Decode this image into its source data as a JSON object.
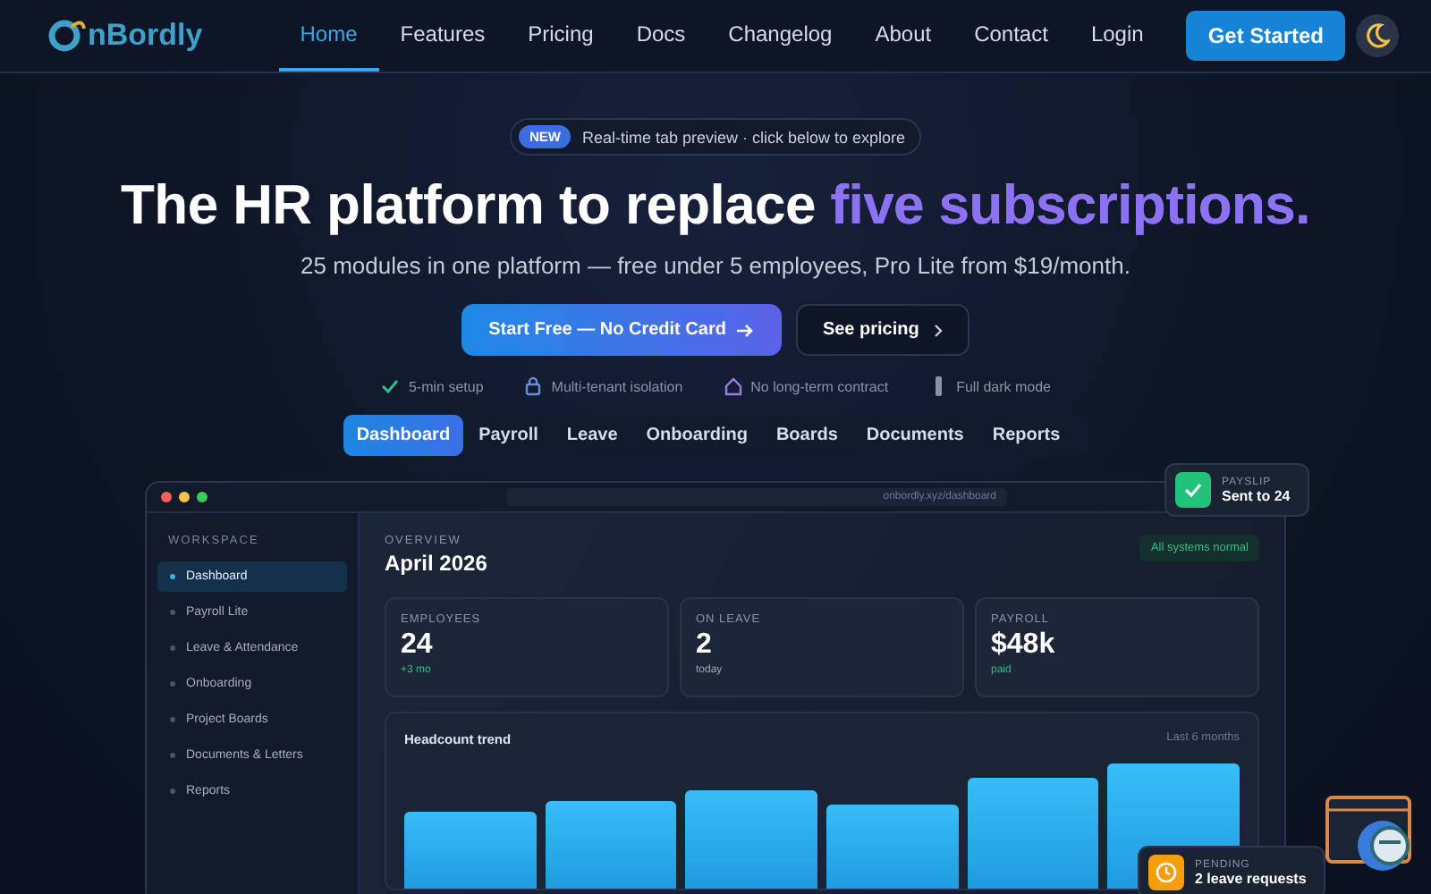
{
  "nav": {
    "logo": "nBordly",
    "links": [
      {
        "label": "Home",
        "selected": true
      },
      {
        "label": "Features",
        "selected": false
      },
      {
        "label": "Pricing",
        "selected": false
      },
      {
        "label": "Docs",
        "selected": false
      },
      {
        "label": "Changelog",
        "selected": false
      },
      {
        "label": "About",
        "selected": false
      },
      {
        "label": "Contact",
        "selected": false
      },
      {
        "label": "Login",
        "selected": false
      }
    ],
    "cta": "Get Started"
  },
  "hero": {
    "badge": "NEW",
    "badge_text": "Real-time tab preview · click below to explore",
    "title_start": "The HR platform to replace ",
    "title_accent": "five subscriptions.",
    "subtitle": "25 modules in one platform — free under 5 employees, Pro Lite from $19/month.",
    "primary_button": "Start Free — No Credit Card",
    "secondary_button": "See pricing",
    "features": [
      {
        "kind": "check",
        "label": "5-min setup"
      },
      {
        "kind": "lock",
        "label": "Multi-tenant isolation"
      },
      {
        "kind": "home",
        "label": "No long-term contract"
      },
      {
        "kind": "bar",
        "label": "Full dark mode"
      }
    ]
  },
  "tabs": [
    {
      "label": "Dashboard",
      "selected": true
    },
    {
      "label": "Payroll",
      "selected": false
    },
    {
      "label": "Leave",
      "selected": false
    },
    {
      "label": "Onboarding",
      "selected": false
    },
    {
      "label": "Boards",
      "selected": false
    },
    {
      "label": "Documents",
      "selected": false
    },
    {
      "label": "Reports",
      "selected": false
    }
  ],
  "preview": {
    "url": "onbordly.xyz/dashboard",
    "sidebar_heading": "WORKSPACE",
    "sidebar_items": [
      {
        "label": "Dashboard",
        "selected": true
      },
      {
        "label": "Payroll Lite",
        "selected": false
      },
      {
        "label": "Leave & Attendance",
        "selected": false
      },
      {
        "label": "Onboarding",
        "selected": false
      },
      {
        "label": "Project Boards",
        "selected": false
      },
      {
        "label": "Documents & Letters",
        "selected": false
      },
      {
        "label": "Reports",
        "selected": false
      }
    ],
    "overline": "OVERVIEW",
    "heading": "April 2026",
    "status": "All systems normal",
    "stats": [
      {
        "label": "EMPLOYEES",
        "value": "24",
        "note": "+3 mo",
        "positive": true
      },
      {
        "label": "ON LEAVE",
        "value": "2",
        "note": "today",
        "positive": false
      },
      {
        "label": "PAYROLL",
        "value": "$48k",
        "note": "paid",
        "positive": true
      }
    ],
    "chart_title": "Headcount trend",
    "chart_range": "Last 6 months"
  },
  "toasts": [
    {
      "kind": "success",
      "label": "PAYSLIP",
      "text": "Sent to 24"
    },
    {
      "kind": "pending",
      "label": "PENDING",
      "text": "2 leave requests"
    }
  ]
}
